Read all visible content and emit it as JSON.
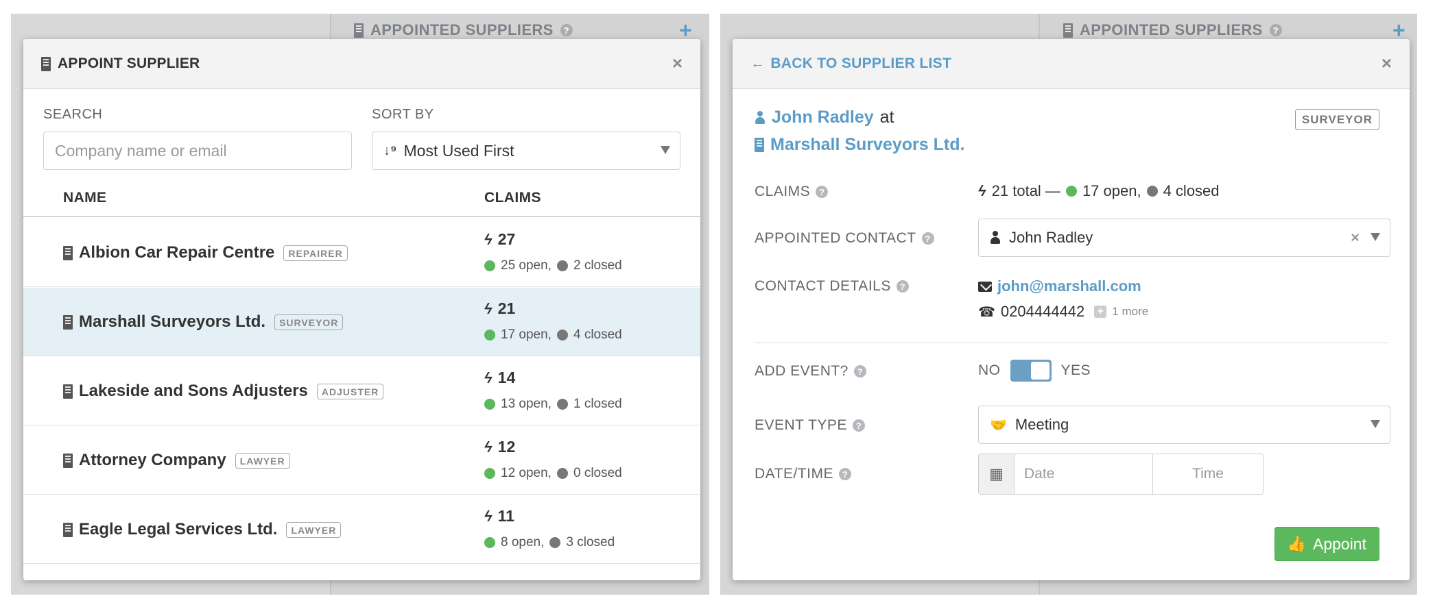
{
  "background": {
    "section_title": "APPOINTED SUPPLIERS",
    "add_symbol": "+"
  },
  "appoint_modal": {
    "title": "APPOINT SUPPLIER",
    "close": "×",
    "search": {
      "label": "SEARCH",
      "placeholder": "Company name or email",
      "value": ""
    },
    "sort": {
      "label": "SORT BY",
      "selected": "Most Used First",
      "icon": "↓¹⁄₉"
    },
    "columns": {
      "name": "NAME",
      "claims": "CLAIMS"
    },
    "rows": [
      {
        "name": "Albion Car Repair Centre",
        "type": "REPAIRER",
        "total": "27",
        "open": "25 open,",
        "closed": "2 closed",
        "selected": false
      },
      {
        "name": "Marshall Surveyors Ltd.",
        "type": "SURVEYOR",
        "total": "21",
        "open": "17 open,",
        "closed": "4 closed",
        "selected": true
      },
      {
        "name": "Lakeside and Sons Adjusters",
        "type": "ADJUSTER",
        "total": "14",
        "open": "13 open,",
        "closed": "1 closed",
        "selected": false
      },
      {
        "name": "Attorney Company",
        "type": "LAWYER",
        "total": "12",
        "open": "12 open,",
        "closed": "0 closed",
        "selected": false
      },
      {
        "name": "Eagle Legal Services Ltd.",
        "type": "LAWYER",
        "total": "11",
        "open": "8 open,",
        "closed": "3 closed",
        "selected": false
      }
    ]
  },
  "detail_modal": {
    "back_label": "BACK TO SUPPLIER LIST",
    "close": "×",
    "contact_name": "John Radley",
    "at": "at",
    "company": "Marshall Surveyors Ltd.",
    "type_badge": "SURVEYOR",
    "claims": {
      "label": "CLAIMS",
      "total": "21 total —",
      "open": "17 open,",
      "closed": "4 closed"
    },
    "appointed_contact": {
      "label": "APPOINTED CONTACT",
      "value": "John Radley"
    },
    "contact_details": {
      "label": "CONTACT DETAILS",
      "email": "john@marshall.com",
      "phone": "0204444442",
      "more": "1 more"
    },
    "add_event": {
      "label": "ADD EVENT?",
      "no": "NO",
      "yes": "YES",
      "value": true
    },
    "event_type": {
      "label": "EVENT TYPE",
      "value": "Meeting"
    },
    "date_time": {
      "label": "DATE/TIME",
      "date_placeholder": "Date",
      "time_placeholder": "Time"
    },
    "appoint_button": "Appoint"
  },
  "colors": {
    "link": "#5b9cc7",
    "open_dot": "#5cb85c",
    "closed_dot": "#777777",
    "selected_row": "#e4f0f6",
    "primary_button": "#5cb85c"
  },
  "icons": {
    "building": "building-icon",
    "bolt": "bolt-icon",
    "help": "question-circle-icon",
    "user": "user-icon",
    "envelope": "envelope-icon",
    "phone": "phone-icon",
    "calendar": "calendar-icon",
    "handshake": "handshake-icon",
    "thumbs_up": "thumbs-up-icon",
    "arrow_left": "arrow-left-icon"
  }
}
